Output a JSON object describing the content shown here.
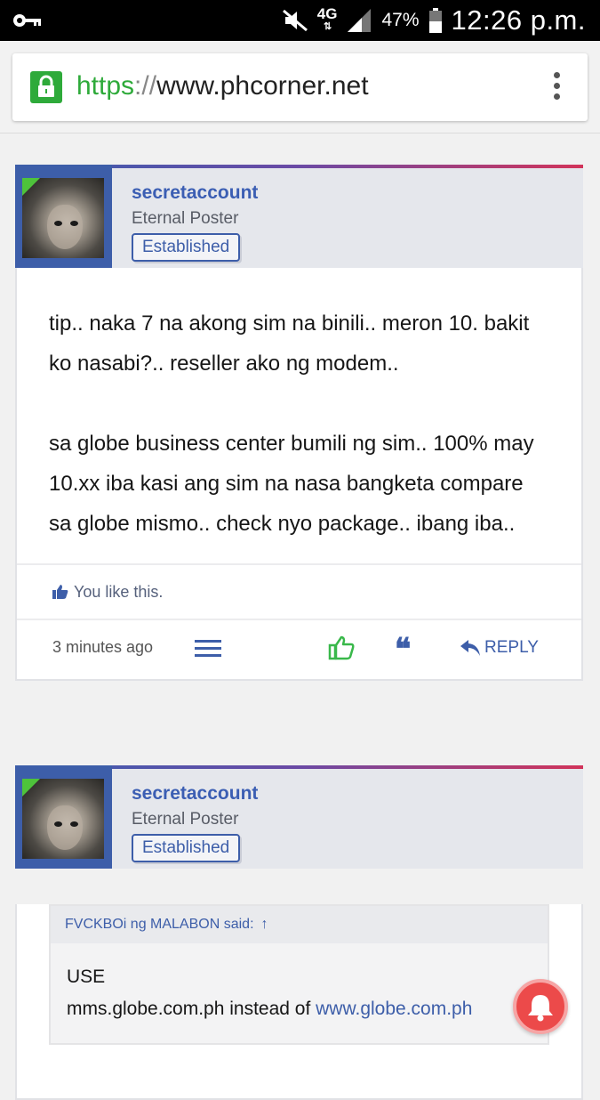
{
  "status_bar": {
    "network": "4G",
    "battery": "47%",
    "time": "12:26 p.m."
  },
  "browser": {
    "url_scheme": "https",
    "url_sep": "://",
    "url_host": "www.phcorner.net"
  },
  "posts": [
    {
      "username": "secretaccount",
      "user_title": "Eternal Poster",
      "badge": "Established",
      "paragraphs": [
        "tip.. naka 7 na akong sim na binili.. meron 10. bakit ko nasabi?.. reseller ako ng modem..",
        "sa globe business center bumili ng sim.. 100% may 10.xx iba kasi ang sim na nasa bangketa compare sa globe mismo.. check nyo package.. ibang iba.."
      ],
      "likes_text": "You like this.",
      "time": "3 minutes ago",
      "reply_label": "REPLY"
    },
    {
      "username": "secretaccount",
      "user_title": "Eternal Poster",
      "badge": "Established",
      "quote": {
        "author_said": "FVCKBOi ng MALABON said:",
        "arrow": "↑",
        "line1": "USE",
        "line2_prefix": "mms.globe.com.ph instead of ",
        "line2_link": "www.globe.com.ph"
      }
    }
  ],
  "colors": {
    "accent": "#3d5ea9",
    "green": "#2eaa3a",
    "alert": "#ec4a4a"
  }
}
